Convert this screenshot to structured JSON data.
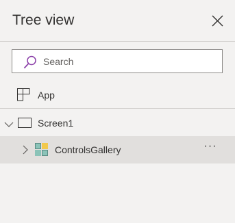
{
  "panel": {
    "title": "Tree view"
  },
  "search": {
    "placeholder": "Search"
  },
  "tree": {
    "app_label": "App",
    "screen_label": "Screen1",
    "gallery_label": "ControlsGallery",
    "more_label": "···"
  },
  "icons": {
    "close": "close-icon",
    "search": "search-icon",
    "app": "app-icon",
    "screen": "screen-icon",
    "gallery": "gallery-icon"
  },
  "colors": {
    "search_icon": "#8a3ea8",
    "selected_row": "#e1dfdd"
  }
}
